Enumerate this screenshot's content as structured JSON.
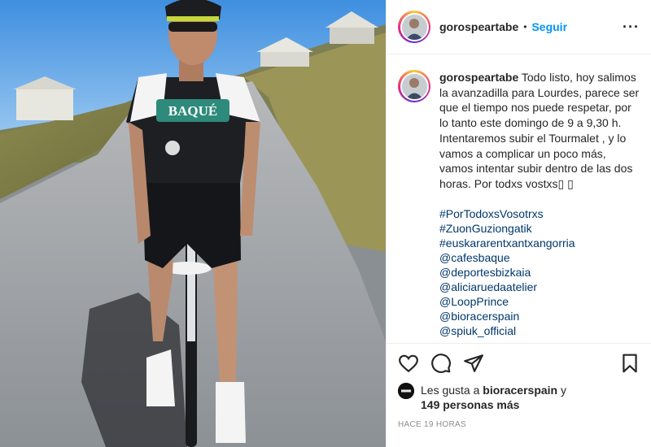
{
  "post": {
    "username": "gorospeartabe",
    "follow_label": "Seguir",
    "separator": "•",
    "more_label": "···"
  },
  "caption": {
    "username": "gorospeartabe",
    "text": "Todo listo, hoy salimos la avanzadilla para Lourdes, parece ser que el tiempo nos puede respetar, por lo tanto este domingo de 9 a 9,30 h. Intentaremos subir el Tourmalet , y lo vamos a complicar un poco más, vamos intentar subir dentro de las dos horas. Por todxs vostxs▯ ▯",
    "tags": [
      "#PorTodoxsVosotrxs",
      "#ZuonGuziongatik",
      "#euskararentxantxangorria",
      "@cafesbaque",
      "@deportesbizkaia",
      "@aliciaruedaatelier",
      "@LoopPrince",
      "@bioracerspain",
      "@spiuk_official"
    ]
  },
  "likes": {
    "prefix": "Les gusta a",
    "user": "bioracerspain",
    "connector": "y",
    "others": "149 personas más"
  },
  "time": "HACE 19 HORAS",
  "jersey_brand": "BAQUÉ",
  "icons": [
    "heart-icon",
    "comment-icon",
    "share-icon",
    "bookmark-icon",
    "more-options-icon"
  ]
}
